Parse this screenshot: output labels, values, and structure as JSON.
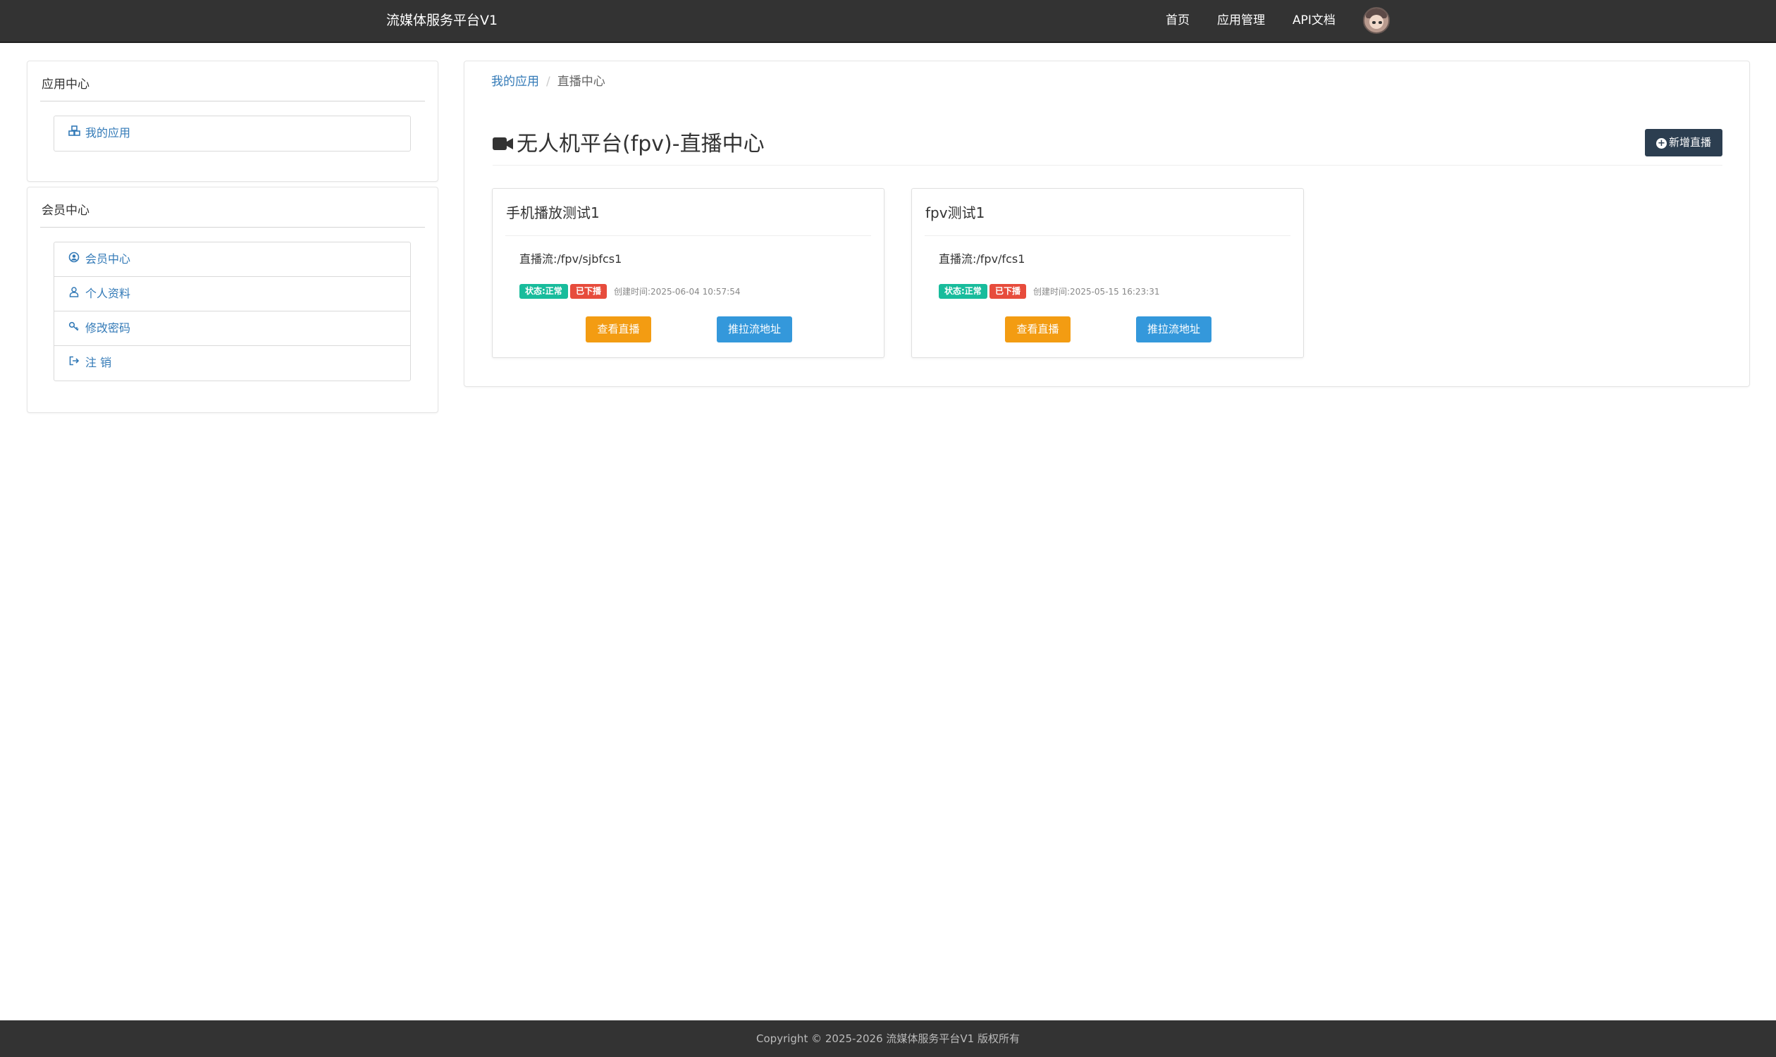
{
  "navbar": {
    "brand": "流媒体服务平台V1",
    "links": [
      "首页",
      "应用管理",
      "API文档"
    ]
  },
  "sidebar": {
    "app_center": {
      "title": "应用中心",
      "items": [
        {
          "label": "我的应用",
          "icon": "cubes-icon"
        }
      ]
    },
    "member_center": {
      "title": "会员中心",
      "items": [
        {
          "label": "会员中心",
          "icon": "user-circle-icon"
        },
        {
          "label": "个人资料",
          "icon": "user-icon"
        },
        {
          "label": "修改密码",
          "icon": "key-icon"
        },
        {
          "label": "注 销",
          "icon": "sign-out-icon"
        }
      ]
    }
  },
  "main": {
    "breadcrumb": {
      "link": "我的应用",
      "separator": "/",
      "active": "直播中心"
    },
    "title": "无人机平台(fpv)-直播中心",
    "new_button": "新增直播",
    "cards": [
      {
        "title": "手机播放测试1",
        "stream": "直播流:/fpv/sjbfcs1",
        "status": "状态:正常",
        "live_state": "已下播",
        "created": "创建时间:2025-06-04 10:57:54",
        "view_button": "查看直播",
        "push_button": "推拉流地址"
      },
      {
        "title": "fpv测试1",
        "stream": "直播流:/fpv/fcs1",
        "status": "状态:正常",
        "live_state": "已下播",
        "created": "创建时间:2025-05-15 16:23:31",
        "view_button": "查看直播",
        "push_button": "推拉流地址"
      }
    ]
  },
  "footer": {
    "text": "Copyright © 2025-2026 流媒体服务平台V1 版权所有"
  },
  "colors": {
    "navbar": "#333333",
    "primary": "#2c3e50",
    "success": "#18bc9c",
    "danger": "#e74c3c",
    "warning": "#f39c12",
    "info": "#3498db",
    "link": "#337ab7"
  }
}
